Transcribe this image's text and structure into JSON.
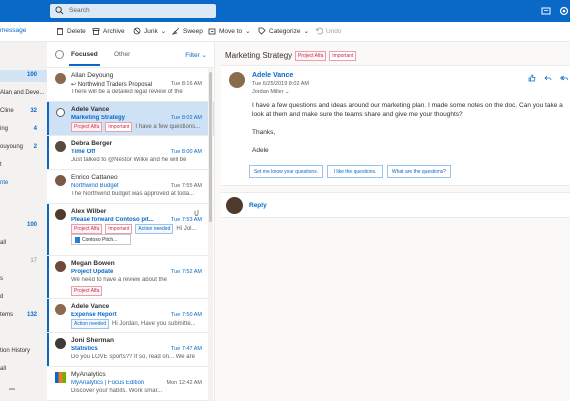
{
  "colors": {
    "brand": "#0a69c7",
    "unread_accent": "#0a69c7",
    "tag_red": "#c4314b"
  },
  "topbar": {
    "search_placeholder": "Search"
  },
  "commands": {
    "new_message": "message",
    "delete": "Delete",
    "archive": "Archive",
    "junk": "Junk",
    "sweep": "Sweep",
    "move_to": "Move to",
    "categorize": "Categorize",
    "undo": "Undo"
  },
  "leftnav": {
    "items": [
      {
        "label": "",
        "count": "100",
        "selected": true
      },
      {
        "label": "Alan and Deve...",
        "count": ""
      },
      {
        "label": "Cline",
        "count": "32"
      },
      {
        "label": "ing",
        "count": "4"
      },
      {
        "label": "",
        "count": ""
      },
      {
        "label": "ouyoung",
        "count": "2"
      },
      {
        "label": "t",
        "count": ""
      },
      {
        "label": "nte",
        "count": "",
        "link": true
      },
      {
        "label": "",
        "count": "100"
      },
      {
        "label": "all",
        "count": ""
      },
      {
        "label": "",
        "count": "17"
      },
      {
        "label": "s",
        "count": ""
      },
      {
        "label": "d",
        "count": ""
      },
      {
        "label": "tems",
        "count": "132"
      },
      {
        "label": "tion History",
        "count": ""
      },
      {
        "label": "all",
        "count": ""
      }
    ]
  },
  "list": {
    "focused_tab": "Focused",
    "other_tab": "Other",
    "filter": "Filter",
    "messages": [
      {
        "sender": "Allan Deyoung",
        "subject": "Northwind Traders Proposal",
        "time": "Tue 8:16 AM",
        "preview": "There will be a detailed legal review of the",
        "unread": false,
        "reply_arrow": true
      },
      {
        "sender": "Adele Vance",
        "subject": "Marketing Strategy",
        "time": "Tue 8:02 AM",
        "tags": [
          "Project Alfa",
          "Important"
        ],
        "preview": "I have a few questions...",
        "unread": true,
        "selected": true
      },
      {
        "sender": "Debra Berger",
        "subject": "Time Off",
        "time": "Tue 8:00 AM",
        "preview": "Just talked to @Nestor Wilke and he will be",
        "unread": true
      },
      {
        "sender": "Enrico Cattaneo",
        "subject": "Northwind Budget",
        "time": "Tue 7:55 AM",
        "preview": "The Northwind budget was approved at toda...",
        "unread": false
      },
      {
        "sender": "Alex Wilber",
        "subject": "Please forward Contoso pit...",
        "time": "Tue 7:53 AM",
        "tags": [
          "Project Alfa",
          "Important",
          "Action needed"
        ],
        "preview": "Hi Jol...",
        "attachment": "Contoso Pitch...",
        "unread": true
      },
      {
        "sender": "Megan Bowen",
        "subject": "Project Update",
        "time": "Tue 7:52 AM",
        "preview": "We need to have a review about the",
        "tags": [
          "Project Alfa"
        ],
        "unread": true
      },
      {
        "sender": "Adele Vance",
        "subject": "Expense Report",
        "time": "Tue 7:50 AM",
        "tags": [
          "Action needed"
        ],
        "preview": "Hi Jordan, Have you submitte...",
        "unread": true
      },
      {
        "sender": "Joni Sherman",
        "subject": "Statistics",
        "time": "Tue 7:47 AM",
        "preview": "Do you LOVE sports?? If so, read on... We are",
        "unread": true
      },
      {
        "sender": "MyAnalytics",
        "subject": "MyAnalytics | Focus Edition",
        "time": "Mon 12:42 AM",
        "preview": "Discover your habits. Work smar...",
        "unread": false
      }
    ]
  },
  "reading": {
    "title": "Marketing Strategy",
    "tags": [
      "Project Alfa",
      "Important"
    ],
    "from": "Adele Vance",
    "date": "Tue 6/25/2019 8:02 AM",
    "to": "Jordan Miller",
    "body": "I have a few questions and ideas around our marketing plan. I made some notes on the doc. Can you take a look at them and make sure the teams share and give me your thoughts?",
    "thanks": "Thanks,",
    "signature": "Adele",
    "suggestions": [
      "Set me know your questions.",
      "I like the questions.",
      "What are the questions?"
    ],
    "reply": "Reply"
  }
}
